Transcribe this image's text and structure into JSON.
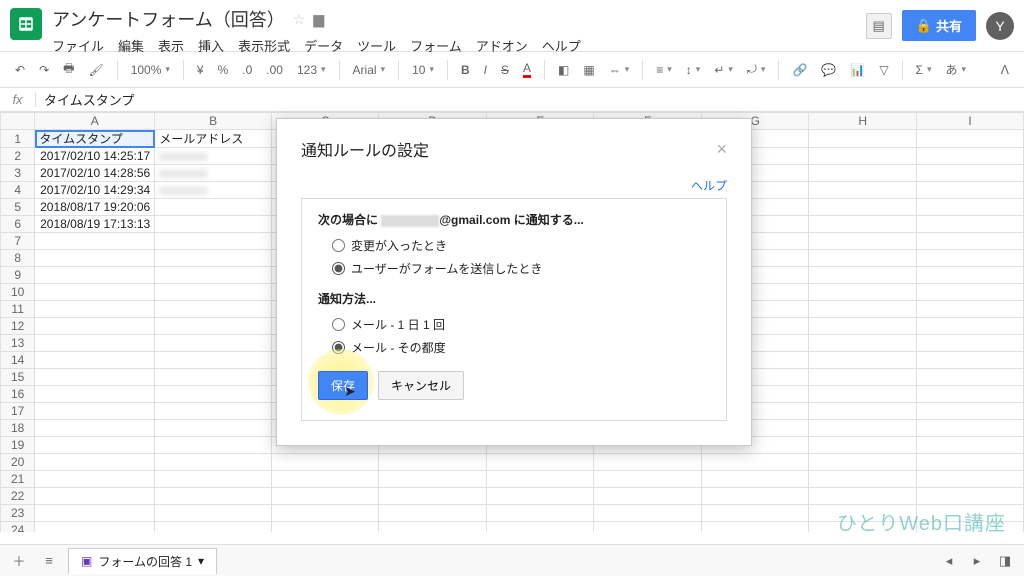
{
  "header": {
    "doc_title": "アンケートフォーム（回答）",
    "share_label": "共有",
    "avatar_letter": "Y"
  },
  "menubar": [
    "ファイル",
    "編集",
    "表示",
    "挿入",
    "表示形式",
    "データ",
    "ツール",
    "フォーム",
    "アドオン",
    "ヘルプ"
  ],
  "toolbar": {
    "zoom": "100%",
    "currency": "¥",
    "percent": "%",
    "dec_dec": ".0",
    "dec_inc": ".00",
    "more_fmt": "123",
    "font": "Arial",
    "size": "10"
  },
  "formula_bar": {
    "fx_label": "fx",
    "cell_value": "タイムスタンプ"
  },
  "columns": [
    "A",
    "B",
    "C",
    "D",
    "E",
    "F",
    "G",
    "H",
    "I"
  ],
  "rows": [
    {
      "n": 1,
      "a": "タイムスタンプ",
      "b": "メールアドレス",
      "a_align": "left",
      "selected": true
    },
    {
      "n": 2,
      "a": "2017/02/10 14:25:17",
      "b": "",
      "blurB": true
    },
    {
      "n": 3,
      "a": "2017/02/10 14:28:56",
      "b": "",
      "blurB": true
    },
    {
      "n": 4,
      "a": "2017/02/10 14:29:34",
      "b": "",
      "blurB": true
    },
    {
      "n": 5,
      "a": "2018/08/17 19:20:06",
      "b": ""
    },
    {
      "n": 6,
      "a": "2018/08/19 17:13:13",
      "b": ""
    },
    {
      "n": 7
    },
    {
      "n": 8
    },
    {
      "n": 9
    },
    {
      "n": 10
    },
    {
      "n": 11
    },
    {
      "n": 12
    },
    {
      "n": 13
    },
    {
      "n": 14
    },
    {
      "n": 15
    },
    {
      "n": 16
    },
    {
      "n": 17
    },
    {
      "n": 18
    },
    {
      "n": 19
    },
    {
      "n": 20
    },
    {
      "n": 21
    },
    {
      "n": 22
    },
    {
      "n": 23
    },
    {
      "n": 24
    }
  ],
  "sheet_tab": {
    "name": "フォームの回答 1"
  },
  "modal": {
    "title": "通知ルールの設定",
    "help": "ヘルプ",
    "section1_prefix": "次の場合に",
    "section1_email_suffix": "@gmail.com に通知する...",
    "opt_changes": "変更が入ったとき",
    "opt_form_submit": "ユーザーがフォームを送信したとき",
    "section2_heading": "通知方法...",
    "opt_daily": "メール - 1 日 1 回",
    "opt_immediate": "メール - その都度",
    "save": "保存",
    "cancel": "キャンセル"
  },
  "watermark": "ひとりWeb口講座"
}
